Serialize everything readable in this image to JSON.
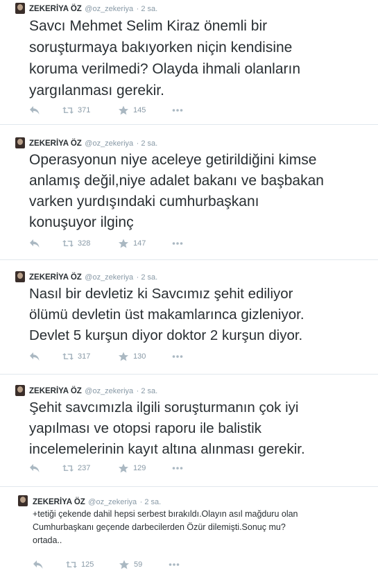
{
  "tweets": [
    {
      "name": "ZEKERİYA ÖZ",
      "handle": "@oz_zekeriya",
      "time": "· 2 sa.",
      "text": "Savcı Mehmet Selim Kiraz önemli bir\nsoruşturmaya bakıyorken niçin kendisine\nkoruma verilmedi? Olayda ihmali olanların\nyargılanması gerekir.",
      "retweets": "371",
      "favorites": "145"
    },
    {
      "name": "ZEKERİYA ÖZ",
      "handle": "@oz_zekeriya",
      "time": "· 2 sa.",
      "text": "Operasyonun niye aceleye getirildiğini kimse\nanlamış değil,niye adalet bakanı ve başbakan\nvarken yurdışındaki cumhurbaşkanı\nkonuşuyor ilginç",
      "retweets": "328",
      "favorites": "147"
    },
    {
      "name": "ZEKERİYA ÖZ",
      "handle": "@oz_zekeriya",
      "time": "· 2 sa.",
      "text": "Nasıl bir devletiz ki Savcımız şehit ediliyor\nölümü devletin üst makamlarınca gizleniyor.\nDevlet 5 kurşun diyor doktor 2 kurşun diyor.",
      "retweets": "317",
      "favorites": "130"
    },
    {
      "name": "ZEKERİYA ÖZ",
      "handle": "@oz_zekeriya",
      "time": "· 2 sa.",
      "text": "Şehit savcımızla ilgili soruşturmanın çok iyi\nyapılması ve otopsi raporu ile balistik\nincelemelerinin kayıt altına alınması gerekir.",
      "retweets": "237",
      "favorites": "129"
    },
    {
      "name": "ZEKERİYA ÖZ",
      "handle": "@oz_zekeriya",
      "time": "· 2 sa.",
      "text": "+tetiği çekende dahil hepsi serbest bırakıldı.Olayın asıl mağduru olan\nCumhurbaşkanı geçende darbecilerden Özür dilemişti.Sonuç mu?\nortada..",
      "retweets": "125",
      "favorites": "59"
    }
  ],
  "icons": {
    "reply": "reply-icon",
    "retweet": "retweet-icon",
    "favorite": "star-icon",
    "more": "more-icon"
  },
  "colors": {
    "text": "#292f33",
    "meta": "#8899a6",
    "icon": "#aab8c2",
    "divider": "#e1e8ed"
  }
}
